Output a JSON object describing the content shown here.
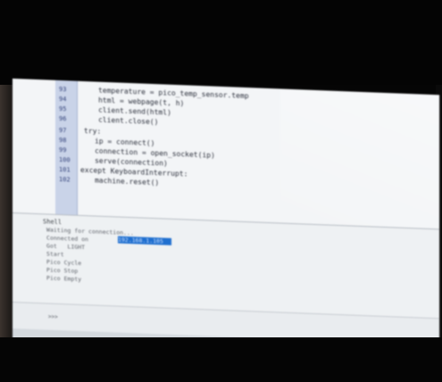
{
  "editor": {
    "lines": [
      {
        "num": "93",
        "code": "temperature = pico_temp_sensor.temp",
        "indent": 2
      },
      {
        "num": "94",
        "code": "html = webpage(t, h)",
        "indent": 2
      },
      {
        "num": "95",
        "code": "client.send(html)",
        "indent": 2
      },
      {
        "num": "96",
        "code": "client.close()",
        "indent": 2
      },
      {
        "num": "97",
        "code": "try:",
        "indent": 0
      },
      {
        "num": "98",
        "code": "ip = connect()",
        "indent": 1
      },
      {
        "num": "99",
        "code": "connection = open_socket(ip)",
        "indent": 1
      },
      {
        "num": "100",
        "code": "serve(connection)",
        "indent": 1
      },
      {
        "num": "101",
        "code": "except KeyboardInterrupt:",
        "indent": 0
      },
      {
        "num": "102",
        "code": "machine.reset()",
        "indent": 1
      }
    ]
  },
  "shell": {
    "label": "Shell",
    "lines": [
      "Waiting for connection...",
      "Connected on",
      "Got   LIGHT",
      "Start",
      "Pico Cycle",
      "Pico Stop",
      "Pico Empty"
    ],
    "ip_highlight": "192.168.1.105"
  },
  "prompt": {
    "text": ">>> "
  }
}
